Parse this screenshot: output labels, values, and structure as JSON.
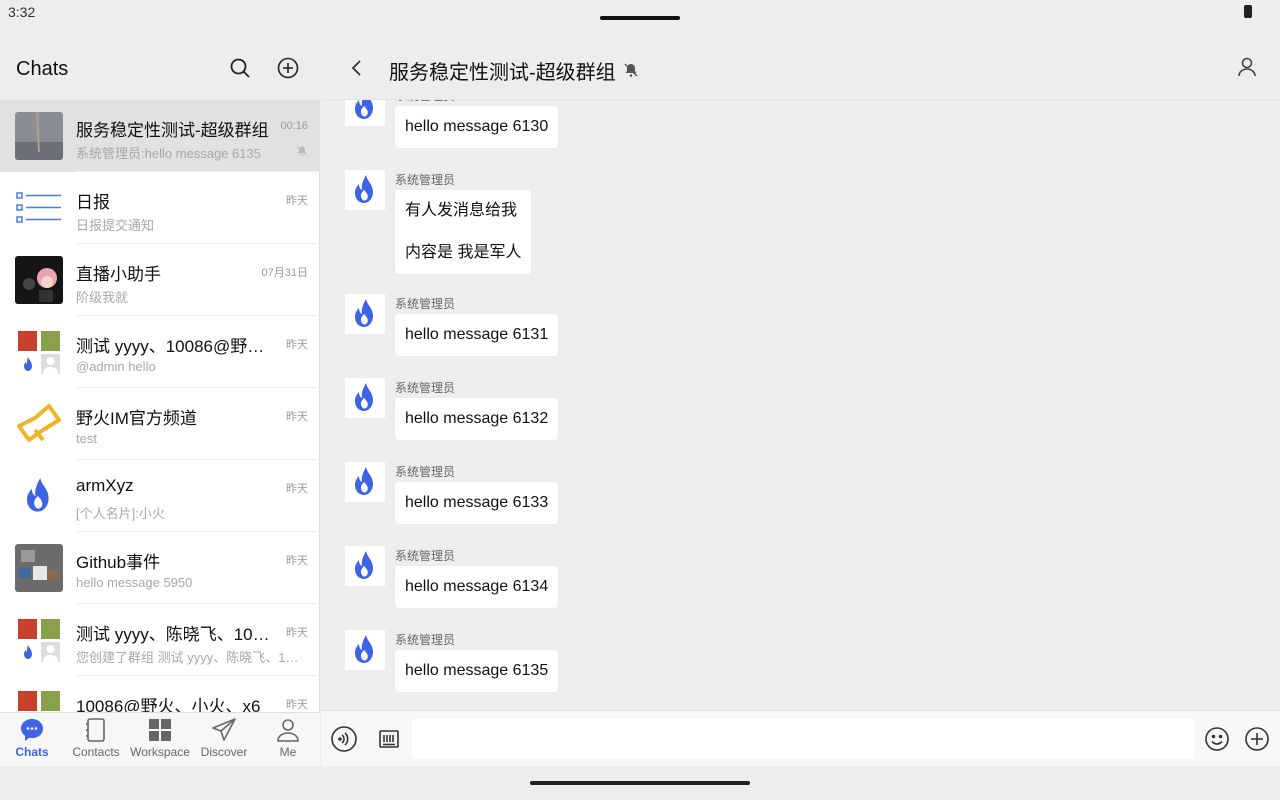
{
  "status_bar": {
    "time": "3:32"
  },
  "left_panel": {
    "title": "Chats",
    "chats": [
      {
        "name": "服务稳定性测试-超级群组",
        "time": "00:16",
        "preview": "系统管理员:hello message 6135",
        "muted": true,
        "active": true,
        "avatar": "photo-avatar"
      },
      {
        "name": "日报",
        "time": "昨天",
        "preview": "日报提交通知",
        "avatar": "list-avatar"
      },
      {
        "name": "直播小助手",
        "time": "07月31日",
        "preview": "阶级我就",
        "avatar": "anime-avatar"
      },
      {
        "name": "测试 yyyy、10086@野火、...",
        "time": "昨天",
        "preview": "@admin hello",
        "avatar": "group-grid-avatar"
      },
      {
        "name": "野火IM官方频道",
        "time": "昨天",
        "preview": "test",
        "avatar": "megaphone-avatar"
      },
      {
        "name": "armXyz",
        "time": "昨天",
        "preview": "[个人名片]:小火",
        "avatar": "flame-avatar"
      },
      {
        "name": "Github事件",
        "time": "昨天",
        "preview": "hello message 5950",
        "avatar": "github-avatar"
      },
      {
        "name": "测试 yyyy、陈晓飞、100...",
        "time": "昨天",
        "preview": "您创建了群组 测试 yyyy、陈晓飞、10...",
        "avatar": "group-grid-avatar"
      },
      {
        "name": "10086@野火、小火、x6",
        "time": "昨天",
        "preview": "",
        "avatar": "group-grid-avatar"
      }
    ],
    "tabs": [
      {
        "label": "Chats",
        "icon": "chat-bubble-icon",
        "active": true
      },
      {
        "label": "Contacts",
        "icon": "contacts-book-icon"
      },
      {
        "label": "Workspace",
        "icon": "grid-icon"
      },
      {
        "label": "Discover",
        "icon": "paper-plane-icon"
      },
      {
        "label": "Me",
        "icon": "person-icon"
      }
    ]
  },
  "conversation": {
    "title": "服务稳定性测试-超级群组",
    "messages": [
      {
        "sender": "系统管理员",
        "lines": [
          "hello message 6130"
        ]
      },
      {
        "sender": "系统管理员",
        "lines": [
          "有人发消息给我",
          "内容是 我是军人"
        ]
      },
      {
        "sender": "系统管理员",
        "lines": [
          "hello message 6131"
        ]
      },
      {
        "sender": "系统管理员",
        "lines": [
          "hello message 6132"
        ]
      },
      {
        "sender": "系统管理员",
        "lines": [
          "hello message 6133"
        ]
      },
      {
        "sender": "系统管理员",
        "lines": [
          "hello message 6134"
        ]
      },
      {
        "sender": "系统管理员",
        "lines": [
          "hello message 6135"
        ]
      }
    ],
    "input_value": ""
  },
  "colors": {
    "accent": "#3e64e6",
    "flame": "#3e64e6",
    "background": "#ededed"
  }
}
